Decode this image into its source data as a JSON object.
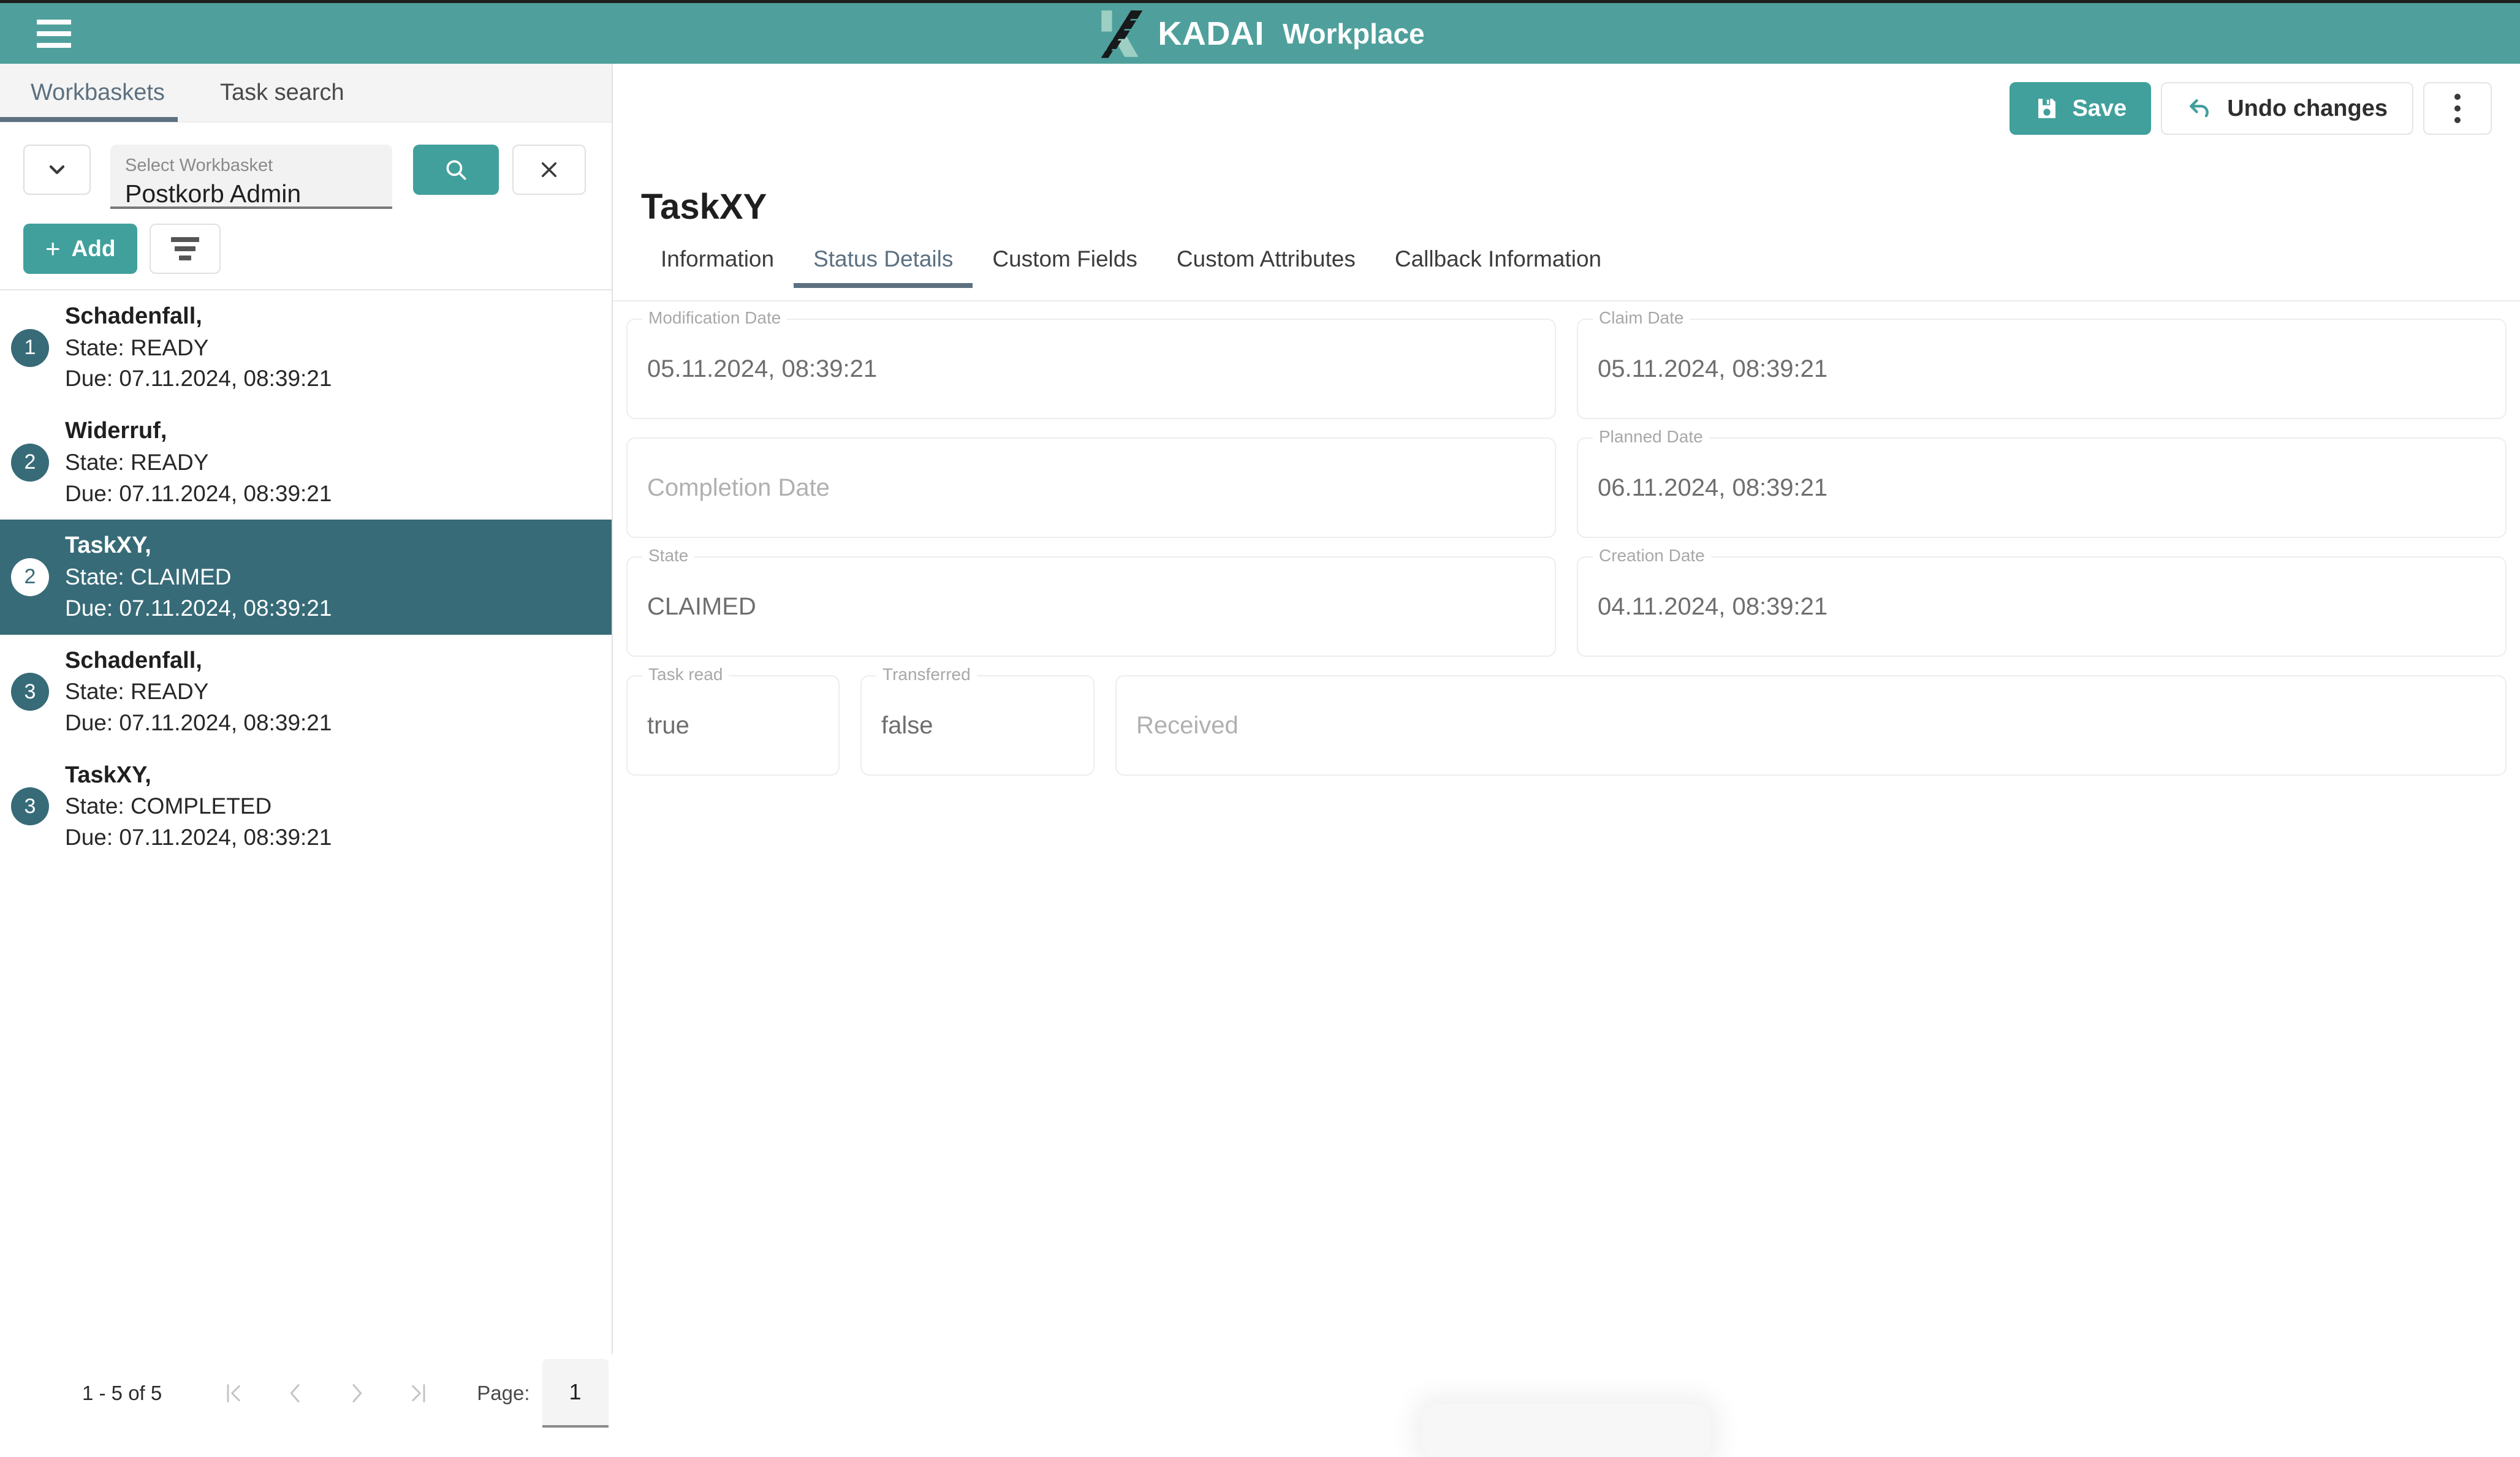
{
  "topbar": {
    "menu_icon": "hamburger-icon",
    "brand_name": "KADAI",
    "brand_sub": "Workplace",
    "bg_color": "#4FA09C"
  },
  "sidebar": {
    "tabs": [
      {
        "label": "Workbaskets",
        "active": true
      },
      {
        "label": "Task search",
        "active": false
      }
    ],
    "workbasket_select": {
      "label": "Select Workbasket",
      "value": "Postkorb Admin",
      "chevron_icon": "chevron-down-icon"
    },
    "search_button": {
      "icon": "search-icon",
      "color": "#41A09C"
    },
    "clear_button": {
      "icon": "close-icon"
    },
    "add_button": {
      "label": "Add",
      "icon": "plus-icon",
      "color": "#41A09C"
    },
    "sort_button": {
      "icon": "sort-icon"
    },
    "tasks": [
      {
        "badge": "1",
        "title": "Schadenfall,",
        "state": "State: READY",
        "due": "Due: 07.11.2024, 08:39:21",
        "selected": false
      },
      {
        "badge": "2",
        "title": "Widerruf,",
        "state": "State: READY",
        "due": "Due: 07.11.2024, 08:39:21",
        "selected": false
      },
      {
        "badge": "2",
        "title": "TaskXY,",
        "state": "State: CLAIMED",
        "due": "Due: 07.11.2024, 08:39:21",
        "selected": true
      },
      {
        "badge": "3",
        "title": "Schadenfall,",
        "state": "State: READY",
        "due": "Due: 07.11.2024, 08:39:21",
        "selected": false
      },
      {
        "badge": "3",
        "title": "TaskXY,",
        "state": "State: COMPLETED",
        "due": "Due: 07.11.2024, 08:39:21",
        "selected": false
      }
    ],
    "paginator": {
      "range": "1 - 5 of 5",
      "first_icon": "first-page-icon",
      "prev_icon": "previous-page-icon",
      "next_icon": "next-page-icon",
      "last_icon": "last-page-icon",
      "page_label": "Page:",
      "page_value": "1"
    },
    "selected_row_color": "#376B78"
  },
  "main": {
    "toolbar": {
      "save_label": "Save",
      "save_icon": "save-icon",
      "undo_label": "Undo changes",
      "undo_icon": "undo-icon",
      "more_icon": "kebab-menu-icon"
    },
    "page_title": "TaskXY",
    "tabs": [
      {
        "label": "Information",
        "active": false
      },
      {
        "label": "Status Details",
        "active": true
      },
      {
        "label": "Custom Fields",
        "active": false
      },
      {
        "label": "Custom Attributes",
        "active": false
      },
      {
        "label": "Callback Information",
        "active": false
      }
    ],
    "fields": {
      "modification_date": {
        "label": "Modification Date",
        "value": "05.11.2024, 08:39:21",
        "empty": false
      },
      "claim_date": {
        "label": "Claim Date",
        "value": "05.11.2024, 08:39:21",
        "empty": false
      },
      "completion_date": {
        "label": "Completion Date",
        "value": "Completion Date",
        "empty": true
      },
      "planned_date": {
        "label": "Planned Date",
        "value": "06.11.2024, 08:39:21",
        "empty": false
      },
      "state": {
        "label": "State",
        "value": "CLAIMED",
        "empty": false
      },
      "creation_date": {
        "label": "Creation Date",
        "value": "04.11.2024, 08:39:21",
        "empty": false
      },
      "task_read": {
        "label": "Task read",
        "value": "true",
        "empty": false
      },
      "transferred": {
        "label": "Transferred",
        "value": "false",
        "empty": false
      },
      "received": {
        "label": "Received",
        "value": "Received",
        "empty": true
      }
    }
  }
}
